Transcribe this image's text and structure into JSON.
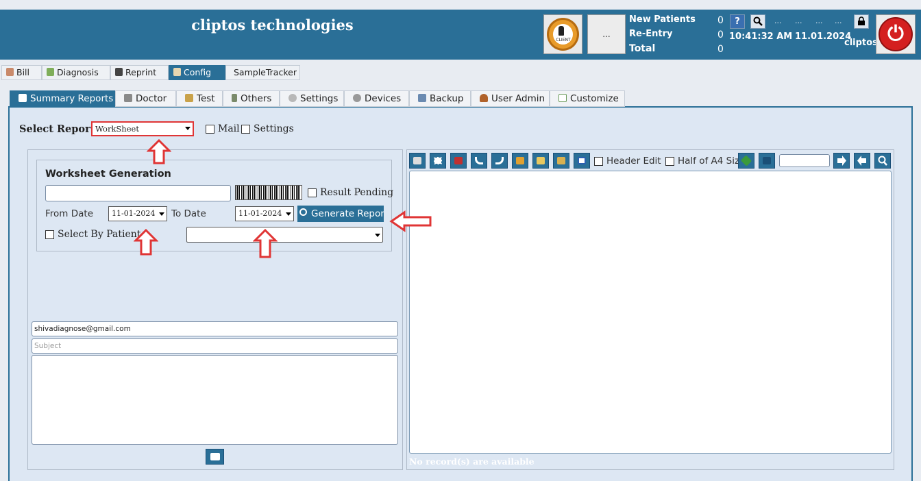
{
  "header": {
    "app_title": "cliptos technologies",
    "client_button_label": "CLIENT",
    "ellipsis_label": "...",
    "stats": [
      {
        "label": "New Patients",
        "value": "0"
      },
      {
        "label": "Re-Entry",
        "value": "0"
      },
      {
        "label": "Total",
        "value": "0"
      }
    ],
    "dots": [
      "...",
      "...",
      "...",
      "..."
    ],
    "time": "10:41:32 AM",
    "date": "11.01.2024",
    "user": "cliptos"
  },
  "top_tabs": [
    {
      "label": "Bill",
      "icon": "person-icon"
    },
    {
      "label": "Diagnosis",
      "icon": "diagnosis-icon"
    },
    {
      "label": "Reprint",
      "icon": "reprint-icon"
    },
    {
      "label": "Config",
      "icon": "user-config-icon",
      "active": true
    },
    {
      "label": "SampleTracker"
    }
  ],
  "sub_tabs": [
    {
      "label": "Summary Reports",
      "active": true
    },
    {
      "label": "Doctor"
    },
    {
      "label": "Test"
    },
    {
      "label": "Others"
    },
    {
      "label": "Settings"
    },
    {
      "label": "Devices"
    },
    {
      "label": "Backup"
    },
    {
      "label": "User Admin"
    },
    {
      "label": "Customize"
    }
  ],
  "reports": {
    "select_label": "Select Reports",
    "selected": "WorkSheet",
    "mail_label": "Mail",
    "settings_label": "Settings"
  },
  "worksheet": {
    "title": "Worksheet Generation",
    "result_pending_label": "Result Pending",
    "from_date_label": "From Date",
    "from_date": "11-01-2024",
    "to_date_label": "To Date",
    "to_date": "11-01-2024",
    "generate_label": "Generate Report",
    "select_by_patient_label": "Select By Patient"
  },
  "mail": {
    "to": "shivadiagnose@gmail.com",
    "subject_placeholder": "Subject"
  },
  "viewer": {
    "header_edit_label": "Header Edit",
    "half_a4_label": "Half of A4 Siz",
    "no_records": "No record(s) are available"
  },
  "colors": {
    "brand": "#2a6f97",
    "annotation_red": "#e03535"
  }
}
